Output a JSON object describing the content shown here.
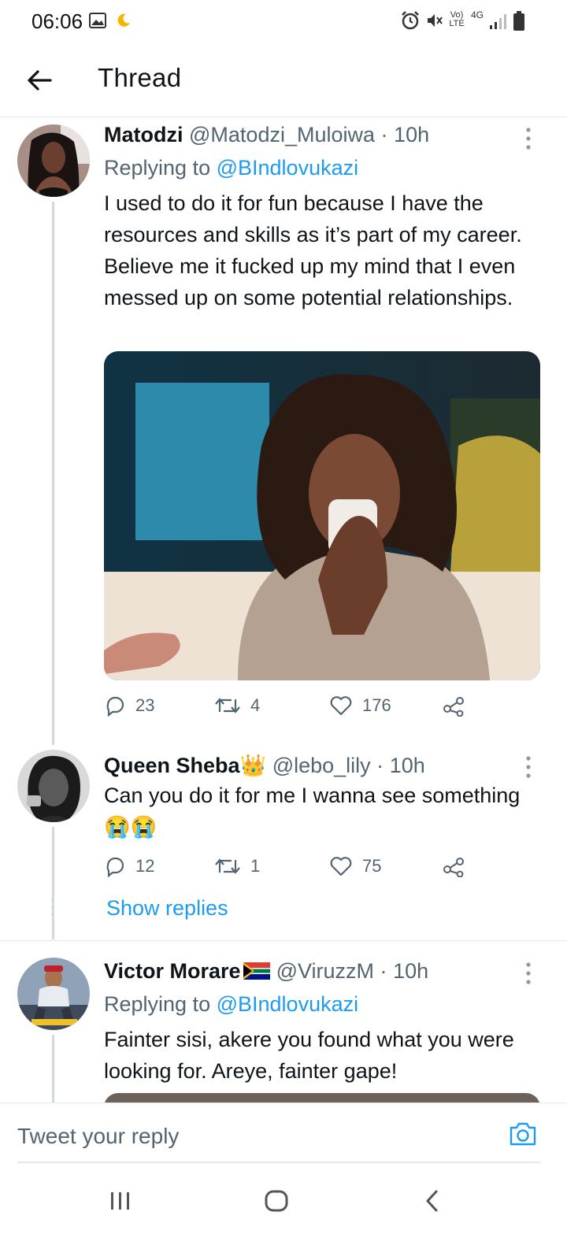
{
  "status_bar": {
    "time": "06:06",
    "network": "4G",
    "volte": "Vo) LTE"
  },
  "header": {
    "title": "Thread"
  },
  "tweets": [
    {
      "name": "Matodzi",
      "handle": "@Matodzi_Muloiwa",
      "time": "10h",
      "replying_prefix": "Replying to",
      "replying_to": "@BIndlovukazi",
      "text": "I used to do it for fun because I have the resources and skills as it’s part of my career. Believe me it fucked up my mind that I even messed up on some potential relationships.",
      "replies": "23",
      "retweets": "4",
      "likes": "176"
    },
    {
      "name": "Queen Sheba",
      "name_emoji": "👑",
      "handle": "@lebo_lily",
      "time": "10h",
      "text": "Can you do it for me I wanna see something",
      "text_emoji": "😭😭",
      "replies": "12",
      "retweets": "1",
      "likes": "75"
    },
    {
      "name": "Victor Morare",
      "handle": "@ViruzzM",
      "time": "10h",
      "replying_prefix": "Replying to",
      "replying_to": "@BIndlovukazi",
      "text": "Fainter sisi, akere you found what you were looking for. Areye, fainter gape!"
    }
  ],
  "show_replies": "Show replies",
  "composer": {
    "placeholder": "Tweet your reply"
  },
  "icons": {
    "back": "arrow-left-icon",
    "more": "more-vertical-icon",
    "reply": "reply-icon",
    "retweet": "retweet-icon",
    "like": "heart-icon",
    "share": "share-icon",
    "camera": "camera-icon"
  },
  "colors": {
    "accent": "#1d9bf0",
    "text": "#0f1419",
    "muted": "#536471",
    "divider": "#e6e9ec"
  }
}
